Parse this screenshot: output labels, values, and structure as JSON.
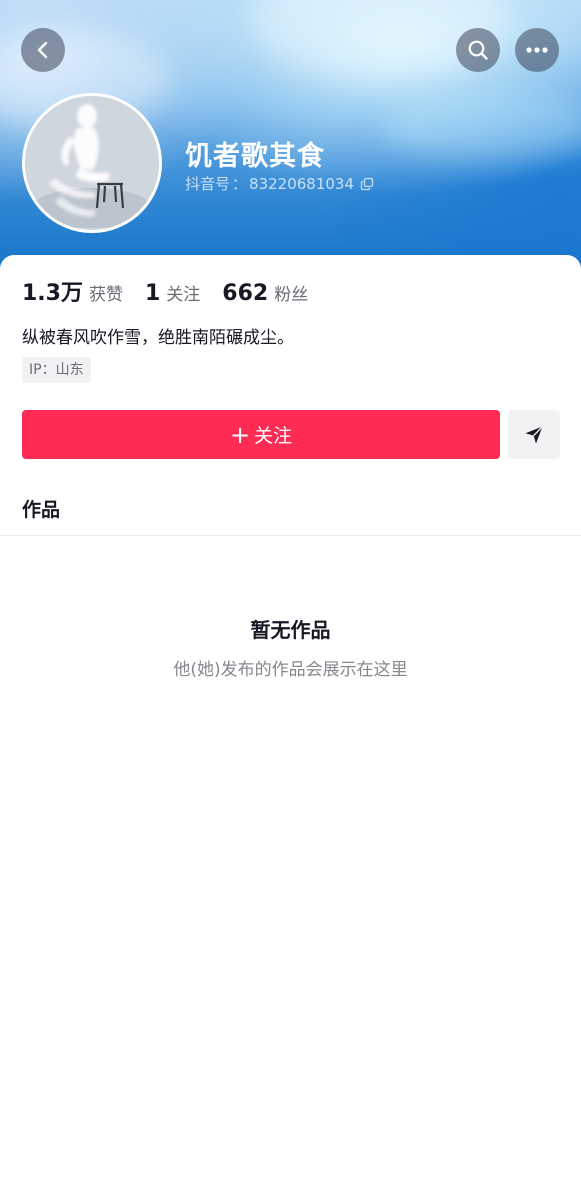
{
  "header": {
    "back_icon": "chevron-left-icon",
    "search_icon": "search-icon",
    "more_icon": "more-horizontal-icon"
  },
  "profile": {
    "nickname": "饥者歌其食",
    "id_label": "抖音号",
    "id_separator": "：",
    "id_value": "83220681034",
    "copy_icon": "copy-icon"
  },
  "stats": [
    {
      "value": "1.3万",
      "label": "获赞"
    },
    {
      "value": "1",
      "label": "关注"
    },
    {
      "value": "662",
      "label": "粉丝"
    }
  ],
  "bio": "纵被春风吹作雪，绝胜南陌碾成尘。",
  "ip_tag": "IP：山东",
  "actions": {
    "follow_plus": "+",
    "follow_label": "关注",
    "share_icon": "send-icon"
  },
  "tabs": {
    "works_label": "作品"
  },
  "empty_state": {
    "title": "暂无作品",
    "description": "他(她)发布的作品会展示在这里"
  },
  "colors": {
    "accent": "#fe2c55",
    "text_primary": "#161823",
    "text_secondary": "#86888e",
    "tag_background": "#f2f2f4"
  }
}
